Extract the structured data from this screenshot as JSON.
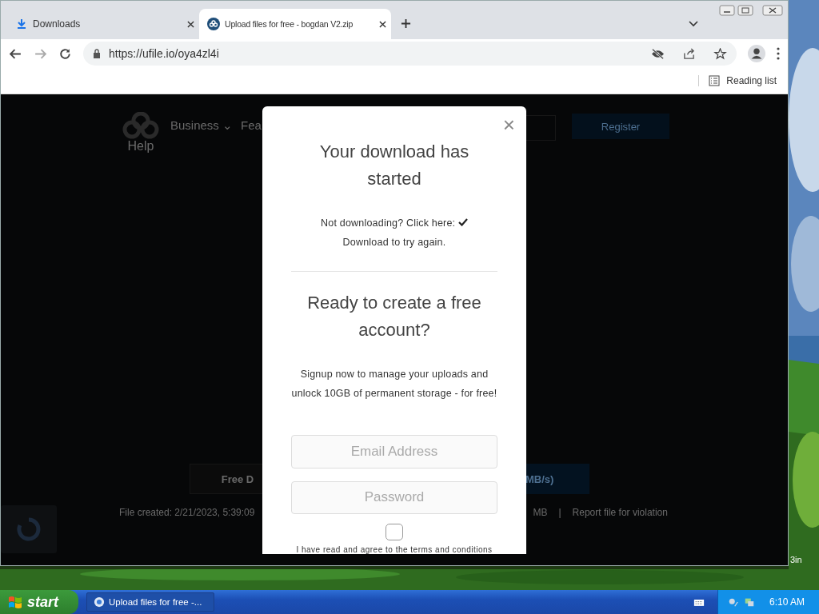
{
  "browser": {
    "tabs": [
      {
        "title": "Downloads",
        "selected": false
      },
      {
        "title": "Upload files for free - bogdan V2.zip",
        "selected": true
      }
    ],
    "url": "https://ufile.io/oya4zl4i",
    "reading_list": "Reading list"
  },
  "site": {
    "nav": [
      {
        "label": "Business ⌄"
      },
      {
        "label": "Fea"
      }
    ],
    "help": "Help",
    "register": "Register",
    "download_button": "Free D",
    "speed": "MB/s)",
    "file_info": "File created: 2/21/2023, 5:39:09",
    "size": "MB",
    "separator": "|",
    "report": "Report file for violation"
  },
  "modal": {
    "close": "×",
    "title": "Your download has started",
    "retry_text": "Not downloading? Click here:",
    "retry_link": "Download to try again.",
    "signup_title": "Ready to create a free account?",
    "signup_text": "Signup now to manage your uploads and unlock 10GB of permanent storage - for free!",
    "email": {
      "placeholder": "Email Address"
    },
    "password": {
      "placeholder": "Password"
    },
    "terms_checked": false,
    "terms": "I have read and agree to the terms and conditions"
  },
  "desktop_label": "3in",
  "taskbar": {
    "start": "start",
    "tasks": [
      {
        "title": "Upload files for free -...",
        "selected": true
      }
    ],
    "time": "6:10 AM"
  }
}
